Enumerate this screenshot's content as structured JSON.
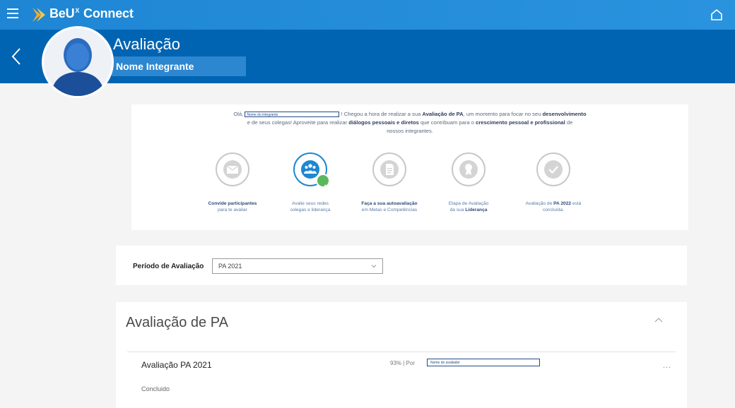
{
  "app": {
    "brand_pre": "BeU",
    "brand_sup": "X",
    "brand_post": "Connect"
  },
  "header": {
    "title": "Avaliação",
    "member_name": "Nome Integrante"
  },
  "intro": {
    "greeting": "Olá,",
    "name_box": "Nome do integrante",
    "text_1": "! Chegou a hora de realizar a sua",
    "bold_1": "Avaliação de PA",
    "text_2": ", um momento para focar no seu",
    "bold_2": "desenvolvimento",
    "text_3": "e de seus colegas! Aproveite para realizar",
    "bold_3": "diálogos pessoais e diretos",
    "text_4": "que contribuam para o",
    "bold_4": "crescimento pessoal e profissional",
    "text_5": "de",
    "text_6": "nossos integrantes."
  },
  "steps": [
    {
      "b": "Convide participantes",
      "t": "para te avaliar",
      "icon": "envelope-icon"
    },
    {
      "t": "Avalie seus redes",
      "t2": "colegas e liderança",
      "icon": "people-icon"
    },
    {
      "b": "Faça a sua autoavaliação",
      "t": "em Metas e Competências",
      "icon": "document-icon"
    },
    {
      "t": "Etapa de Avaliação",
      "t2": "da sua",
      "b": "Liderança",
      "icon": "award-icon"
    },
    {
      "t": "Avaliação de",
      "b": "PA 2022",
      "t2": "está",
      "t3": "concluída.",
      "icon": "check-icon"
    }
  ],
  "period": {
    "label": "Período de Avaliação",
    "value": "PA 2021"
  },
  "pa_section": {
    "title": "Avaliação de PA",
    "row_title": "Avaliação PA 2021",
    "progress": "93% | Por",
    "evaluator": "Nome do avaliador",
    "status": "Concluido",
    "more": "..."
  },
  "colors": {
    "topbar": "#1e86d4",
    "header": "#0064b2",
    "accent": "#1e88d2",
    "success": "#5cb85c"
  }
}
